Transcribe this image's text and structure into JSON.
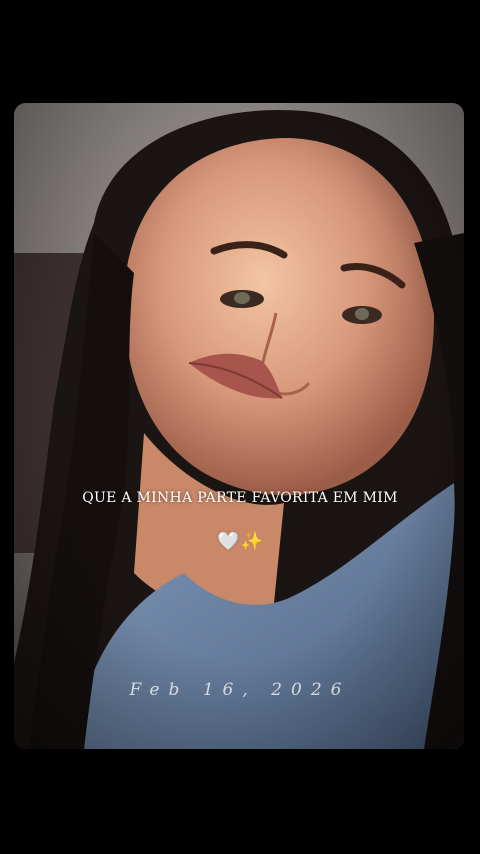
{
  "caption": {
    "text": "QUE A MINHA PARTE FAVORITA EM MIM"
  },
  "emoji": {
    "heart": "🤍",
    "sparkle": "✨"
  },
  "date": {
    "text": "Feb 16, 2026"
  },
  "colors": {
    "background": "#000000",
    "caption": "#ffffff",
    "date": "#e9edf3"
  }
}
